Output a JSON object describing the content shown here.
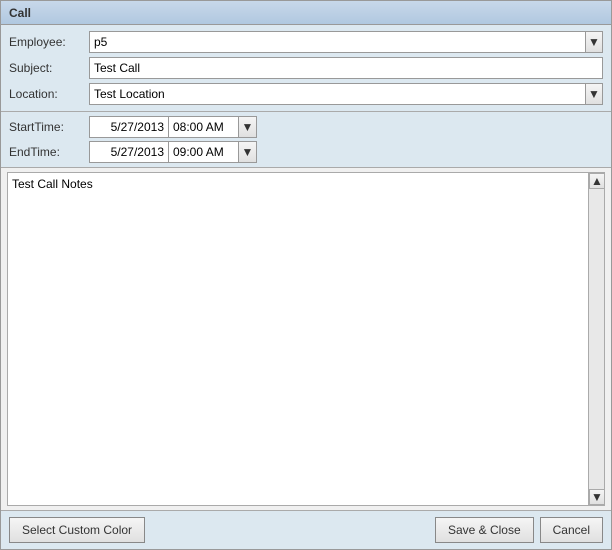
{
  "window": {
    "title": "Call"
  },
  "form": {
    "employee_label": "Employee:",
    "employee_value": "p5",
    "subject_label": "Subject:",
    "subject_value": "Test Call",
    "location_label": "Location:",
    "location_value": "Test Location"
  },
  "datetime": {
    "start_label": "StartTime:",
    "start_date": "5/27/2013",
    "start_time": "08:00 AM",
    "end_label": "EndTime:",
    "end_date": "5/27/2013",
    "end_time": "09:00 AM"
  },
  "notes": {
    "value": "Test Call Notes"
  },
  "footer": {
    "custom_color_label": "Select Custom Color",
    "save_close_label": "Save & Close",
    "cancel_label": "Cancel"
  },
  "icons": {
    "dropdown_arrow": "▼",
    "scroll_up": "▲",
    "scroll_down": "▼"
  }
}
